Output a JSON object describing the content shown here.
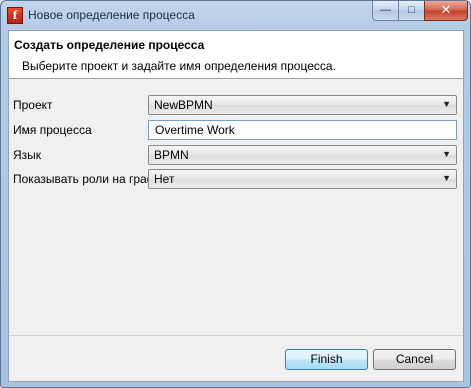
{
  "window": {
    "title": "Новое определение процесса",
    "app_icon_glyph": "f",
    "controls": {
      "minimize": "—",
      "maximize": "□",
      "close": "✕"
    }
  },
  "header": {
    "title": "Создать определение процесса",
    "description": "Выберите проект и задайте имя определения процесса."
  },
  "form": {
    "project": {
      "label": "Проект",
      "value": "NewBPMN"
    },
    "name": {
      "label": "Имя процесса",
      "value": "Overtime Work"
    },
    "language": {
      "label": "Язык",
      "value": "BPMN"
    },
    "show_roles": {
      "label": "Показывать роли на графе",
      "value": "Нет"
    }
  },
  "buttons": {
    "finish": "Finish",
    "cancel": "Cancel"
  },
  "colors": {
    "frame_blue": "#b4cbe6",
    "close_red": "#c2412a",
    "default_button_blue": "#bee6fd"
  }
}
